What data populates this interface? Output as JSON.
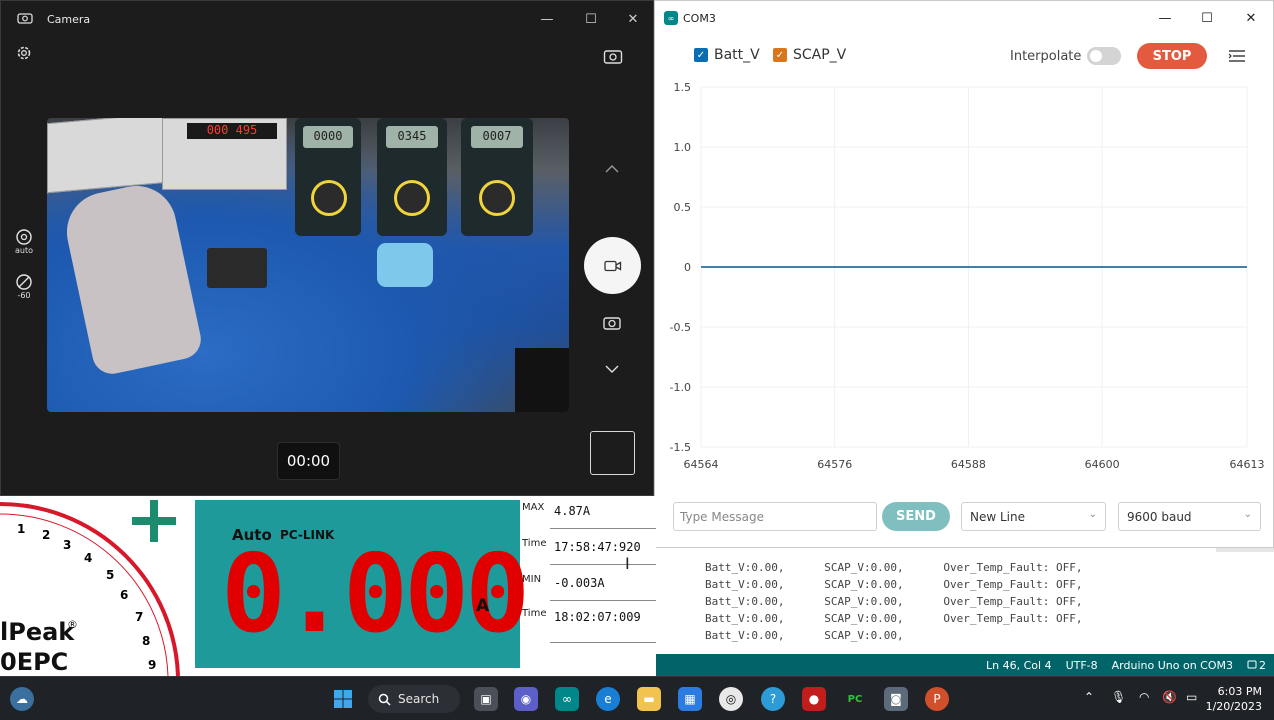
{
  "camera": {
    "title": "Camera",
    "controls": {
      "minimize": "—",
      "maximize": "☐",
      "close": "✕"
    },
    "side": {
      "auto_label": "auto",
      "ev_label": "-60"
    },
    "timer": "00:00",
    "preview_lcds": [
      "000",
      "495",
      "0000",
      "0345",
      "0007"
    ]
  },
  "com3": {
    "title": "COM3",
    "controls": {
      "minimize": "—",
      "maximize": "☐",
      "close": "✕"
    },
    "legend": [
      {
        "label": "Batt_V",
        "color": "#0a6db3"
      },
      {
        "label": "SCAP_V",
        "color": "#d9751a"
      }
    ],
    "interpolate_label": "Interpolate",
    "interpolate_on": false,
    "stop_label": "STOP",
    "message_placeholder": "Type Message",
    "send_label": "SEND",
    "line_ending": "New Line",
    "baud": "9600 baud"
  },
  "chart_data": {
    "type": "line",
    "x": [
      64564,
      64576,
      64588,
      64600,
      64613
    ],
    "xticks": [
      "64564",
      "64576",
      "64588",
      "64600",
      "64613"
    ],
    "yticks": [
      "1.5",
      "1.0",
      "0.5",
      "0",
      "-0.5",
      "-1.0",
      "-1.5"
    ],
    "ylim": [
      -1.5,
      1.5
    ],
    "xlim": [
      64564,
      64613
    ],
    "series": [
      {
        "name": "Batt_V",
        "color": "#0a6db3",
        "x": [
          64564,
          64613
        ],
        "y": [
          0,
          0
        ]
      },
      {
        "name": "SCAP_V",
        "color": "#d9751a",
        "x": [
          64564,
          64613
        ],
        "y": [
          0,
          0
        ]
      }
    ],
    "grid": true
  },
  "serial": {
    "lines": [
      "Batt_V:0.00,      SCAP_V:0.00,      Over_Temp_Fault: OFF,",
      "Batt_V:0.00,      SCAP_V:0.00,      Over_Temp_Fault: OFF,",
      "Batt_V:0.00,      SCAP_V:0.00,      Over_Temp_Fault: OFF,",
      "Batt_V:0.00,      SCAP_V:0.00,      Over_Temp_Fault: OFF,",
      "Batt_V:0.00,      SCAP_V:0.00,"
    ]
  },
  "statusbar": {
    "position": "Ln 46, Col 4",
    "encoding": "UTF-8",
    "board": "Arduino Uno on COM3",
    "notifications": "2"
  },
  "pclink": {
    "dial_numbers": [
      "1",
      "2",
      "3",
      "4",
      "5",
      "6",
      "7",
      "8",
      "9"
    ],
    "brand_top": "lPeak",
    "brand_reg": "®",
    "brand_bottom": "0EPC",
    "auto_label": "Auto",
    "pclink_label": "PC-LINK",
    "reading": "0.000",
    "unit": "A",
    "max_label": "MAX",
    "max_value": "4.87A",
    "time_label": "Time",
    "max_time": "17:58:47:920",
    "min_label": "MIN",
    "min_value": "-0.003A",
    "min_time": "18:02:07:009"
  },
  "taskbar": {
    "search_label": "Search",
    "time": "6:03 PM",
    "date": "1/20/2023"
  }
}
